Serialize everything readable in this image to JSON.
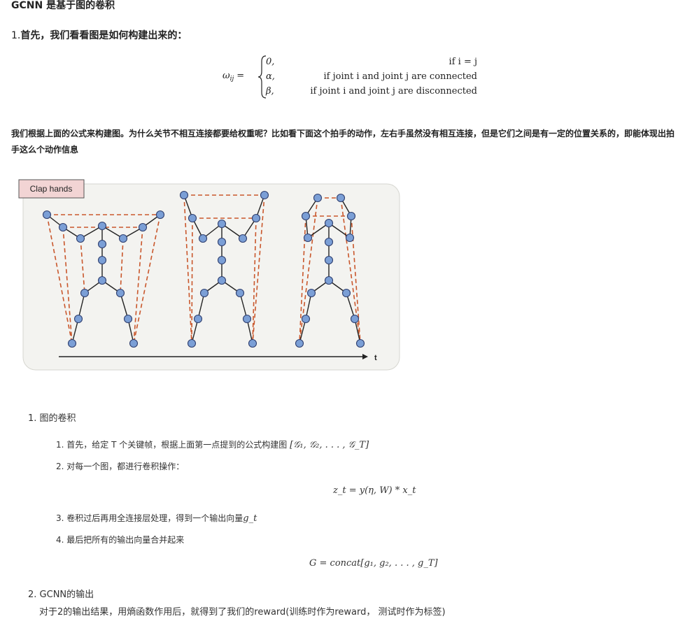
{
  "heading": "GCNN 是基于图的卷积",
  "section1": {
    "number": "1.",
    "title": "首先，我们看看图是如何构建出来的："
  },
  "formula1": {
    "lhs": "ω",
    "lhs_sub": "ij",
    "eq": "=",
    "rows": [
      {
        "value": "0,",
        "condition": "if i = j"
      },
      {
        "value": "α,",
        "condition": "if joint i and joint j are connected"
      },
      {
        "value": "β,",
        "condition": "if joint i and joint j are disconnected"
      }
    ]
  },
  "paragraph": "我们根据上面的公式来构建图。为什么关节不相互连接都要给权重呢？比如看下面这个拍手的动作，左右手虽然没有相互连接，但是它们之间是有一定的位置关系的，即能体现出拍手这么个动作信息",
  "figure": {
    "label": "Clap hands",
    "axis_label": "t",
    "colors": {
      "node_fill": "#7b9fd6",
      "node_stroke": "#2f3f6f",
      "bone": "#222222",
      "dashed": "#c9572c",
      "label_bg": "#f2d4d4",
      "panel_bg": "#f3f3f0"
    }
  },
  "list": {
    "item1": {
      "number": "1.",
      "title": "图的卷积"
    },
    "sub1": {
      "number": "1.",
      "text": "首先，给定 T 个关键帧，根据上面第一点提到的公式构建图 ",
      "math": "[𝒢₁, 𝒢₂, . . . , 𝒢_T]"
    },
    "sub2": {
      "number": "2.",
      "text": "对每一个图，都进行卷积操作："
    },
    "formula2": "z_t = y(η, W) * x_t",
    "sub3": {
      "number": "3.",
      "text": "卷积过后再用全连接层处理，得到一个输出向量",
      "math": "g_t"
    },
    "sub4": {
      "number": "4.",
      "text": "最后把所有的输出向量合并起来"
    },
    "formula3": "G = concat[g₁, g₂, . . . , g_T]",
    "item2": {
      "number": "2.",
      "title": "GCNN的输出"
    },
    "item2_text": "对于2的输出结果，用熵函数作用后，就得到了我们的reward(训练时作为reward， 测试时作为标签)"
  }
}
